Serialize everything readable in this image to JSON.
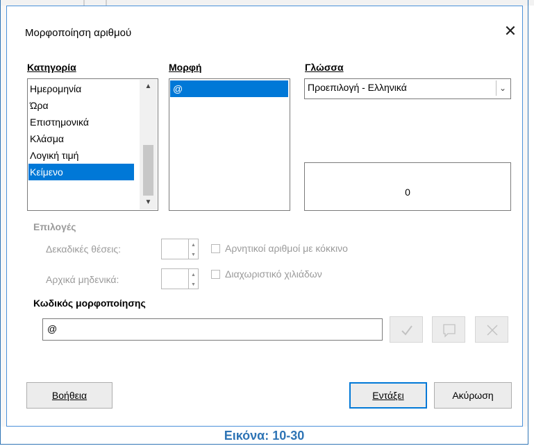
{
  "dialog": {
    "title": "Μορφοποίηση αριθμού",
    "close_glyph": "✕"
  },
  "category": {
    "label": "Κατηγορία",
    "items": [
      "Ημερομηνία",
      "Ώρα",
      "Επιστημονικά",
      "Κλάσμα",
      "Λογική τιμή",
      "Κείμενο"
    ],
    "selected": "Κείμενο"
  },
  "format": {
    "label": "Μορφή",
    "items": [
      "@"
    ],
    "selected": "@"
  },
  "language": {
    "label": "Γλώσσα",
    "value": "Προεπιλογή - Ελληνικά"
  },
  "preview": {
    "value": "0"
  },
  "options": {
    "label": "Επιλογές",
    "decimal_places_label": "Δεκαδικές θέσεις:",
    "leading_zeros_label": "Αρχικά μηδενικά:",
    "negative_red_label": "Αρνητικοί αριθμοί με κόκκινο",
    "thousands_sep_label": "Διαχωριστικό χιλιάδων"
  },
  "format_code": {
    "label": "Κωδικός μορφοποίησης",
    "value": "@"
  },
  "icons": {
    "apply": "check-icon",
    "comment": "comment-icon",
    "delete": "delete-icon"
  },
  "buttons": {
    "help": "Βοήθεια",
    "ok": "Εντάξει",
    "cancel": "Ακύρωση"
  },
  "colors": {
    "selection": "#0078d7",
    "caption": "#2e74b5"
  },
  "caption": "Εικόνα: 10-30"
}
